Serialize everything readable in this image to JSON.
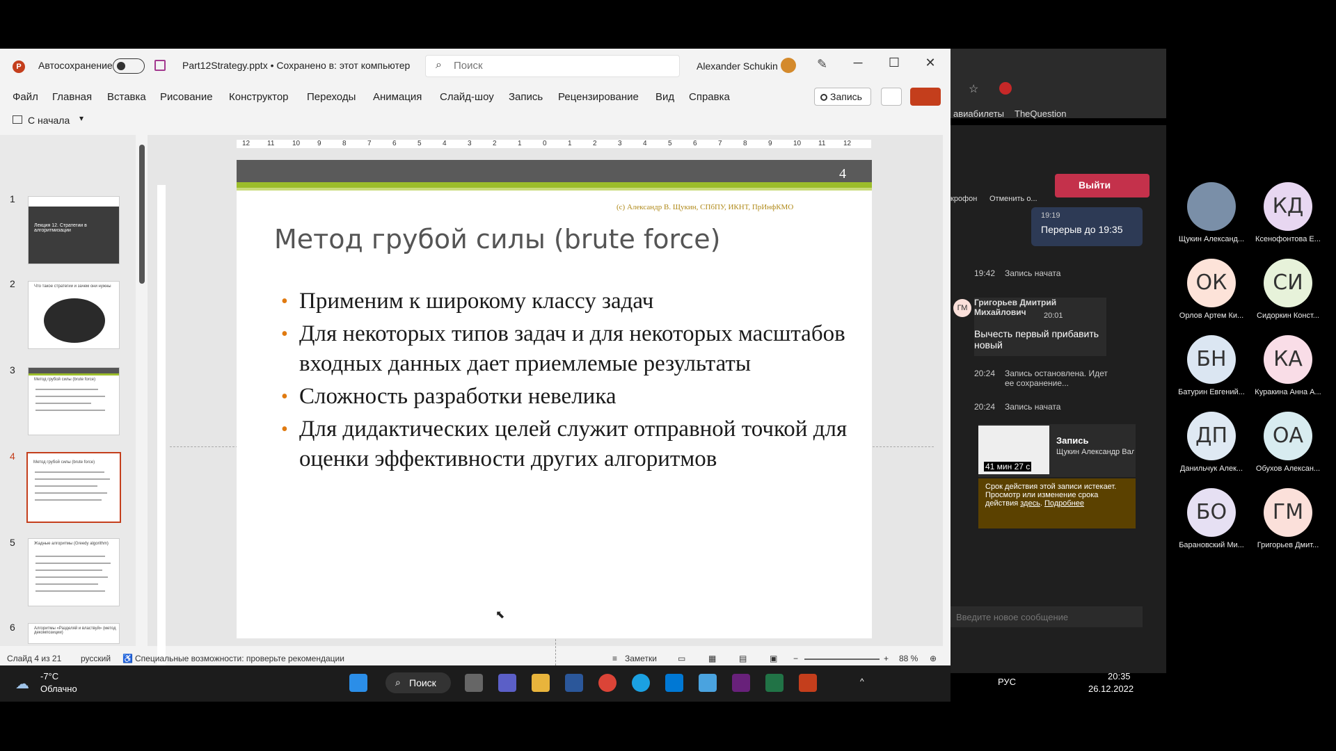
{
  "app": {
    "autosave_label": "Автосохранение",
    "doc_title": "Part12Strategy.pptx • Сохранено в: этот компьютер",
    "search_placeholder": "Поиск",
    "user_name": "Alexander Schukin"
  },
  "menu": [
    "Файл",
    "Главная",
    "Вставка",
    "Рисование",
    "Конструктор",
    "Переходы",
    "Анимация",
    "Слайд-шоу",
    "Запись",
    "Рецензирование",
    "Вид",
    "Справка"
  ],
  "record_button": "Запись",
  "quick": {
    "from_start": "С начала"
  },
  "thumbnails": [
    {
      "num": "1",
      "title": "Лекция 12. Стратегии в алгоритмизации"
    },
    {
      "num": "2",
      "title": "Что такое стратегии и зачем они нужны"
    },
    {
      "num": "3",
      "title": "Метод грубой силы (brute force)"
    },
    {
      "num": "4",
      "title": "Метод грубой силы (brute force)"
    },
    {
      "num": "5",
      "title": "Жадные алгоритмы (Greedy algorithm)"
    },
    {
      "num": "6",
      "title": "Алгоритмы «Разделяй и властвуй» (метод декомпозиции)"
    }
  ],
  "ruler_h": [
    "12",
    "11",
    "10",
    "9",
    "8",
    "7",
    "6",
    "5",
    "4",
    "3",
    "2",
    "1",
    "0",
    "1",
    "2",
    "3",
    "4",
    "5",
    "6",
    "7",
    "8",
    "9",
    "10",
    "11",
    "12"
  ],
  "slide": {
    "number": "4",
    "credit": "(с) Александр В. Щукин, СПбПУ, ИКНТ, ПрИнфКМО",
    "title": "Метод грубой силы (brute force)",
    "bullets": [
      "Применим к широкому классу задач",
      "Для некоторых типов задач и для некоторых масштабов входных данных дает приемлемые результаты",
      "Сложность разработки невелика",
      "Для дидактических целей служит отправной точкой для оценки эффективности других алгоритмов"
    ]
  },
  "status": {
    "slide_of": "Слайд 4 из 21",
    "language": "русский",
    "accessibility": "Специальные возможности: проверьте рекомендации",
    "notes": "Заметки",
    "zoom": "88 %"
  },
  "browser": {
    "bookmark1": "авиабилеты",
    "bookmark2": "TheQuestion"
  },
  "teams": {
    "mic_label": "крофон",
    "cancel_label": "Отменить о...",
    "leave_label": "Выйти",
    "break_time": "19:19",
    "break_text": "Перерыв до 19:35",
    "events": [
      {
        "time": "19:42",
        "text": "Запись начата"
      },
      {
        "time": "20:24",
        "text": "Запись остановлена. Идет ее сохранение..."
      },
      {
        "time": "20:24",
        "text": "Запись начата"
      }
    ],
    "chat_author": "Григорьев Дмитрий Михайлович",
    "chat_time": "20:01",
    "chat_text": "Вычесть первый прибавить новый",
    "chat_avatar": "ГМ",
    "rec_title": "Запись",
    "rec_author": "Щукин Александр Вале...",
    "rec_duration": "41 мин 27 с",
    "rec_notice": "Срок действия этой записи истекает. Просмотр или изменение срока действия",
    "rec_link1": "здесь",
    "rec_link2": "Подробнее",
    "compose_placeholder": "Введите новое сообщение"
  },
  "participants": [
    {
      "initials": "",
      "name": "Щукин Александ...",
      "color": "#7a8fa8"
    },
    {
      "initials": "КД",
      "name": "Ксенофонтова Е...",
      "color": "#e8d7f1"
    },
    {
      "initials": "ОК",
      "name": "Орлов Артем Ки...",
      "color": "#fde3d9"
    },
    {
      "initials": "СИ",
      "name": "Сидоркин Конст...",
      "color": "#e7f2da"
    },
    {
      "initials": "БН",
      "name": "Батурин Евгений...",
      "color": "#dbe6f2"
    },
    {
      "initials": "КА",
      "name": "Куракина Анна А...",
      "color": "#f9dde7"
    },
    {
      "initials": "ДП",
      "name": "Данильчук Алек...",
      "color": "#dfe9f3"
    },
    {
      "initials": "ОА",
      "name": "Обухов Алексан...",
      "color": "#d8ecf0"
    },
    {
      "initials": "БО",
      "name": "Барановский Ми...",
      "color": "#e6e0f3"
    },
    {
      "initials": "ГМ",
      "name": "Григорьев Дмит...",
      "color": "#fbe0da"
    }
  ],
  "taskbar": {
    "temp": "-7°C",
    "weather": "Облачно",
    "search": "Поиск",
    "lang": "РУС",
    "time": "20:35",
    "date": "26.12.2022"
  }
}
